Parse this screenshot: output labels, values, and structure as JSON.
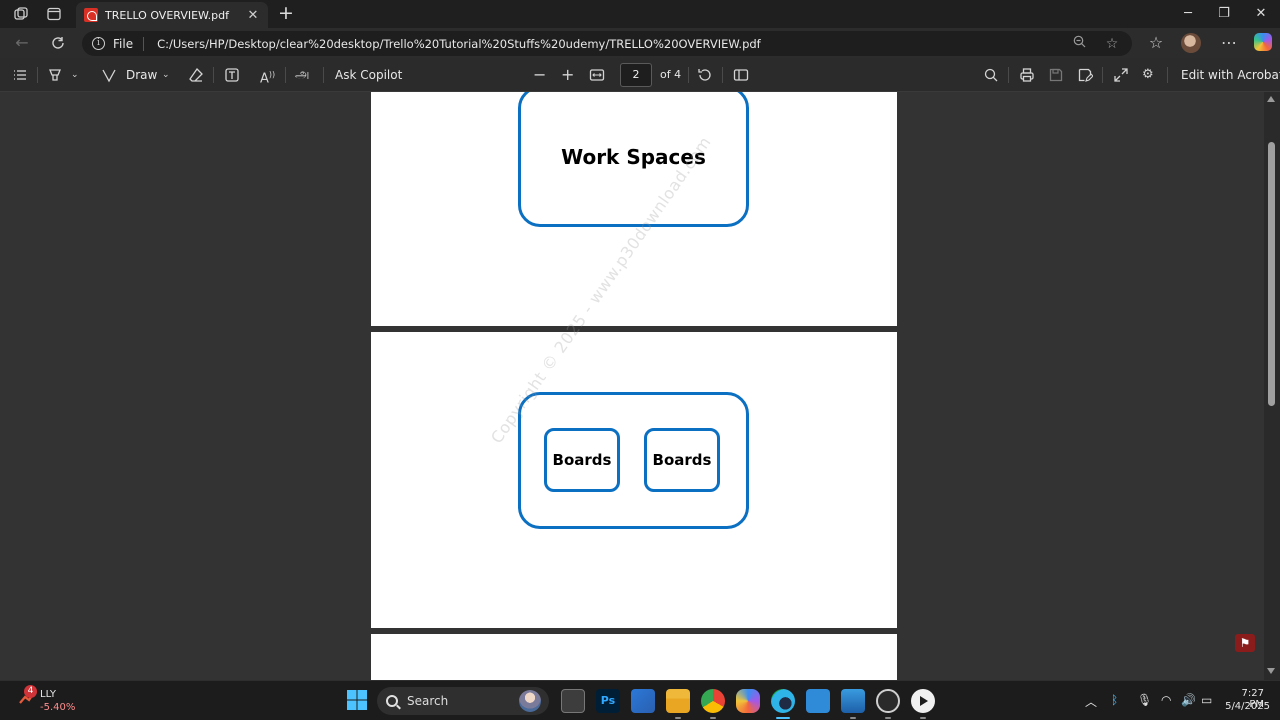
{
  "browser": {
    "tab_title": "TRELLO OVERVIEW.pdf",
    "tab_close": "✕",
    "new_tab": "+",
    "url_scheme": "File",
    "url": "C:/Users/HP/Desktop/clear%20desktop/Trello%20Tutorial%20Stuffs%20udemy/TRELLO%20OVERVIEW.pdf"
  },
  "pdf_toolbar": {
    "draw_label": "Draw",
    "ask_copilot_label": "Ask Copilot",
    "page_current": "2",
    "page_of": "of 4",
    "edit_acrobat_label": "Edit with Acrobat"
  },
  "document": {
    "workspace_label": "Work Spaces",
    "board_1_label": "Boards",
    "board_2_label": "Boards",
    "watermark": "Copyright © 2025 - www.p30download.com",
    "shape_color": "#0b6fc2"
  },
  "taskbar": {
    "stock_badge": "4",
    "stock_name": "LLY",
    "stock_change": "-5.40%",
    "search_label": "Search",
    "time": "7:27 PM",
    "date": "5/4/2025"
  },
  "colors": {
    "accent": "#4cc2ff",
    "page_bg": "#ffffff",
    "viewer_bg": "#333333"
  }
}
